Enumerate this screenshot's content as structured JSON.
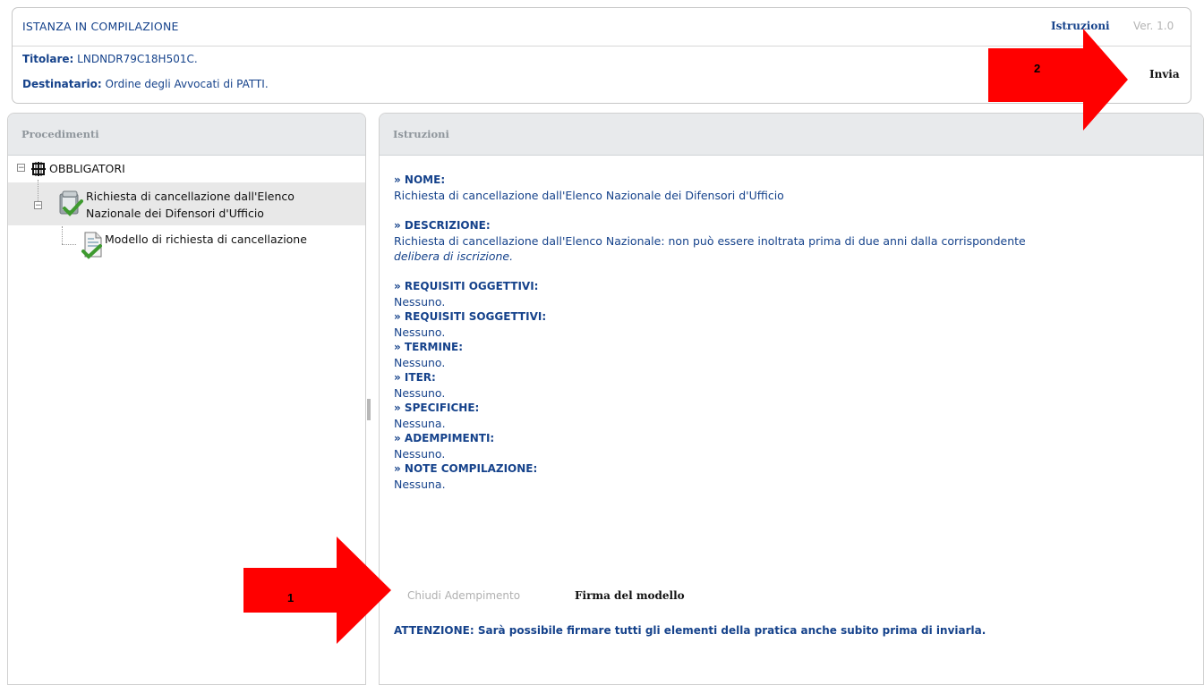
{
  "header": {
    "status_title": "ISTANZA IN COMPILAZIONE",
    "instructions_link": "Istruzioni",
    "version": "Ver. 1.0",
    "titolare_label": "Titolare:",
    "titolare_value": " LNDNDR79C18H501C.",
    "destinatario_label": "Destinatario:",
    "destinatario_value": " Ordine degli Avvocati di PATTI.",
    "send_label": "Invia"
  },
  "left_panel": {
    "title": "Procedimenti",
    "tree": {
      "root_label": "OBBLIGATORI",
      "item_label_line1": "Richiesta di cancellazione dall'Elenco",
      "item_label_line2": "Nazionale dei Difensori d'Ufficio",
      "subitem_label": "Modello di richiesta di cancellazione"
    }
  },
  "right_panel": {
    "title": "Istruzioni",
    "nome_h": "» NOME:",
    "nome_t": "Richiesta di cancellazione dall'Elenco Nazionale dei Difensori d'Ufficio",
    "descr_h": "» DESCRIZIONE:",
    "descr_t1": "Richiesta di cancellazione dall'Elenco Nazionale: non può essere inoltrata prima di due anni dalla corrispondente",
    "descr_t2": "delibera di iscrizione.",
    "req_ogg_h": "» REQUISITI OGGETTIVI:",
    "req_ogg_t": "Nessuno.",
    "req_sogg_h": "» REQUISITI SOGGETTIVI:",
    "req_sogg_t": "Nessuno.",
    "termine_h": "» TERMINE:",
    "termine_t": "Nessuno.",
    "iter_h": "» ITER:",
    "iter_t": "Nessuno.",
    "spec_h": "» SPECIFICHE:",
    "spec_t": "Nessuna.",
    "adem_h": "» ADEMPIMENTI:",
    "adem_t": "Nessuno.",
    "note_h": "» NOTE COMPILAZIONE:",
    "note_t": "Nessuna.",
    "close_button": "Chiudi Adempimento",
    "sign_button": "Firma del modello",
    "attention": "ATTENZIONE: Sarà possibile firmare tutti gli elementi della pratica anche subito prima di inviarla."
  },
  "annotations": {
    "arrow1_number": "1",
    "arrow2_number": "2",
    "arrow_color": "#ff0000"
  }
}
